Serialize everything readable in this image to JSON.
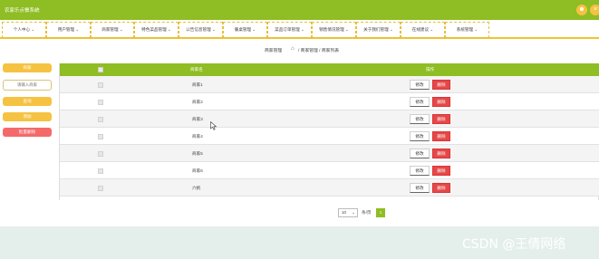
{
  "header": {
    "title": "农家乐点餐系统"
  },
  "topbar_icons": [
    "user-icon",
    "close-icon"
  ],
  "nav": [
    {
      "label": "个人中心",
      "caret": "⌄"
    },
    {
      "label": "用户管理",
      "caret": "⌄"
    },
    {
      "label": "商家管理",
      "caret": "⌄"
    },
    {
      "label": "特色菜品管理",
      "caret": "⌄"
    },
    {
      "label": "公告信息管理",
      "caret": "⌄"
    },
    {
      "label": "餐桌管理",
      "caret": "⌄"
    },
    {
      "label": "菜品订单管理",
      "caret": "⌄"
    },
    {
      "label": "销售情况管理",
      "caret": "⌄"
    },
    {
      "label": "关于我们管理",
      "caret": "⌄"
    },
    {
      "label": "在线建议",
      "caret": "⌄"
    },
    {
      "label": "系统管理",
      "caret": "⌄"
    }
  ],
  "breadcrumb": {
    "section": "商家管理",
    "path": "/ 商家管理 / 商家列表"
  },
  "sidebar": {
    "top_button": "商家",
    "search_placeholder": "请输入商家",
    "search_button": "查询",
    "add_button": "添加",
    "batch_delete_button": "批量删除"
  },
  "colors": {
    "accent": "#8fbd24",
    "warning": "#f5c242",
    "danger": "#e54848",
    "nav_border": "#f1c232"
  },
  "table": {
    "headers": {
      "name": "商家名",
      "actions": "操作"
    },
    "edit_label": "修改",
    "delete_label": "删除",
    "rows": [
      {
        "name": "商家1"
      },
      {
        "name": "商家2"
      },
      {
        "name": "商家3"
      },
      {
        "name": "商家4"
      },
      {
        "name": "商家5"
      },
      {
        "name": "商家6"
      },
      {
        "name": "六帆"
      }
    ]
  },
  "pagination": {
    "page_size": "10",
    "page_size_suffix": "条/页",
    "current_page": "1"
  },
  "watermark": "CSDN @王倩网络"
}
